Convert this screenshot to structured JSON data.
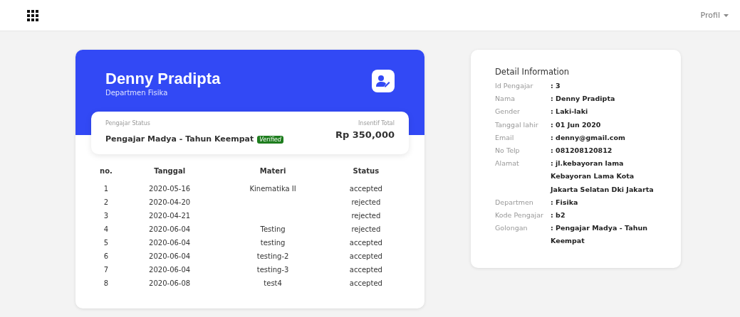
{
  "topbar": {
    "profile_menu": "Profil"
  },
  "profile": {
    "name": "Denny Pradipta",
    "department": "Departmen Fisika",
    "status_label": "Pengajar Status",
    "status_value": "Pengajar Madya - Tahun Keempat",
    "badge": "Verified",
    "incentive_label": "Insentif Total",
    "incentive_value": "Rp 350,000"
  },
  "table": {
    "columns": [
      "no.",
      "Tanggal",
      "Materi",
      "Status"
    ],
    "rows": [
      {
        "no": "1",
        "tanggal": "2020-05-16",
        "materi": "Kinematika II",
        "status": "accepted"
      },
      {
        "no": "2",
        "tanggal": "2020-04-20",
        "status": "rejected"
      },
      {
        "no": "3",
        "tanggal": "2020-04-21",
        "status": "rejected"
      },
      {
        "no": "4",
        "tanggal": "2020-06-04",
        "materi": "Testing",
        "status": "rejected"
      },
      {
        "no": "5",
        "tanggal": "2020-06-04",
        "materi": "testing",
        "status": "accepted"
      },
      {
        "no": "6",
        "tanggal": "2020-06-04",
        "materi": "testing-2",
        "status": "accepted"
      },
      {
        "no": "7",
        "tanggal": "2020-06-04",
        "materi": "testing-3",
        "status": "accepted"
      },
      {
        "no": "8",
        "tanggal": "2020-06-08",
        "materi": "test4",
        "status": "accepted"
      }
    ]
  },
  "detail": {
    "title": "Detail Information",
    "fields": [
      {
        "label": "Id Pengajar",
        "value": ": 3"
      },
      {
        "label": "Nama",
        "value": ": Denny Pradipta"
      },
      {
        "label": "Gender",
        "value": ": Laki-laki"
      },
      {
        "label": "Tanggal lahir",
        "value": ": 01 Jun 2020"
      },
      {
        "label": "Email",
        "value": ": denny@gmail.com"
      },
      {
        "label": "No Telp",
        "value": ": 081208120812"
      },
      {
        "label": "Alamat",
        "value": ": jl.kebayoran lama Kebayoran Lama Kota Jakarta Selatan Dki Jakarta"
      },
      {
        "label": "Departmen",
        "value": ": Fisika"
      },
      {
        "label": "Kode Pengajar",
        "value": ": b2"
      },
      {
        "label": "Golongan",
        "value": ": Pengajar Madya - Tahun Keempat"
      }
    ]
  }
}
